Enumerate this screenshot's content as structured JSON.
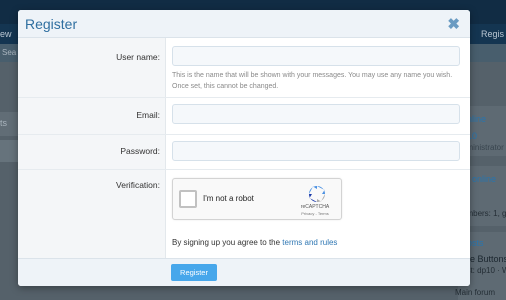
{
  "background": {
    "nav_left": "ew",
    "nav_right": "Regis",
    "sub_left": "Sea",
    "left_block_text": "ts",
    "right_items": [
      {
        "text": "online"
      },
      {
        "text": "p10"
      },
      {
        "text": "dministrator"
      },
      {
        "text": "rs online"
      },
      {
        "text": "embers: 1, gu"
      },
      {
        "text": "posts"
      },
      {
        "text": "are Buttons"
      },
      {
        "text": "ast: dp10 · W"
      },
      {
        "text": "Main forum"
      }
    ]
  },
  "modal": {
    "title": "Register",
    "close_icon": "close-icon",
    "fields": {
      "username": {
        "label": "User name:",
        "value": "",
        "hint_line1": "This is the name that will be shown with your messages. You may use any name you wish.",
        "hint_line2": "Once set, this cannot be changed."
      },
      "email": {
        "label": "Email:",
        "value": ""
      },
      "password": {
        "label": "Password:",
        "value": ""
      },
      "verification": {
        "label": "Verification:"
      }
    },
    "captcha": {
      "checkbox_label": "I'm not a robot",
      "brand": "reCAPTCHA",
      "terms": "Privacy - Terms"
    },
    "agree_text": "By signing up you agree to the ",
    "agree_link": "terms and rules",
    "submit_label": "Register"
  }
}
